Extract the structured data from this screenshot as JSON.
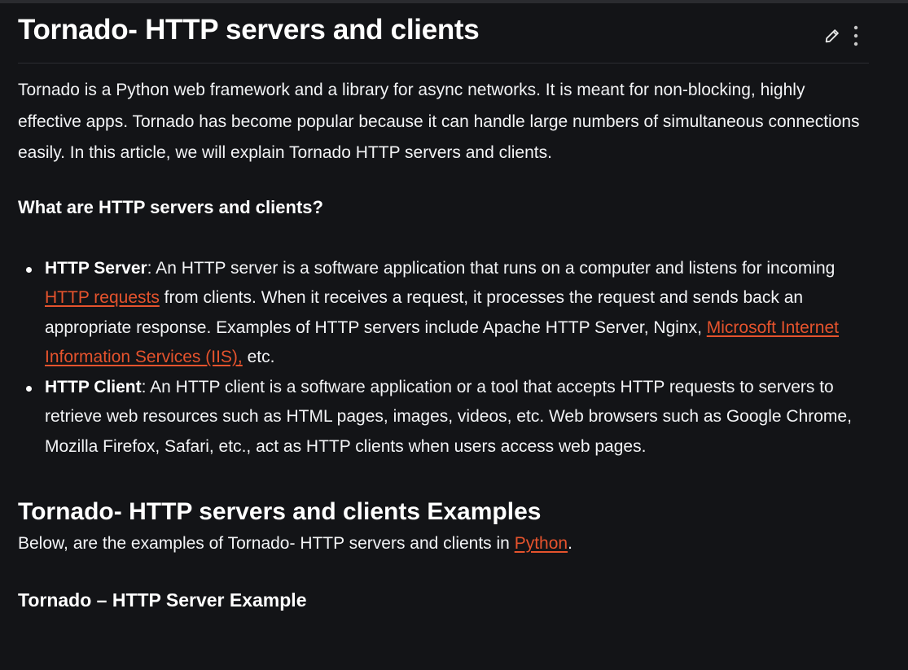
{
  "article": {
    "title": "Tornado- HTTP servers and clients",
    "intro": "Tornado is a Python web framework and a library for async networks. It is meant for non-blocking, highly effective apps. Tornado has become popular because it can handle large numbers of simultaneous connections easily. In this article, we will explain Tornado HTTP servers and clients.",
    "section_heading": "What are HTTP servers and clients?",
    "server": {
      "term": "HTTP Server",
      "text_1": ": An HTTP server is a software application that runs on a computer and listens for incoming ",
      "link_1": "HTTP requests",
      "text_2": " from clients. When it receives a request, it processes the request and sends back an appropriate response. Examples of HTTP servers include Apache HTTP Server, Nginx, ",
      "link_2": "Microsoft Internet Information Services (IIS),",
      "text_3": " etc."
    },
    "client": {
      "term": "HTTP Client",
      "text": ": An HTTP client is a software application or a tool that accepts HTTP requests to servers to retrieve web resources such as HTML pages, images, videos, etc. Web browsers such as Google Chrome, Mozilla Firefox, Safari, etc., act as HTTP clients when users access web pages."
    },
    "examples_heading": "Tornado- HTTP servers and clients Examples",
    "examples_intro": {
      "text_1": "Below, are the examples of Tornado- HTTP servers and clients in ",
      "link": "Python",
      "text_2": "."
    },
    "server_example_heading": "Tornado – HTTP Server Example"
  },
  "toolbar": {
    "edit_icon": "pencil-icon",
    "more_icon": "kebab-menu-icon"
  },
  "colors": {
    "background": "#131417",
    "text": "#ffffff",
    "link": "#e5532d",
    "divider": "#2c2d31"
  }
}
